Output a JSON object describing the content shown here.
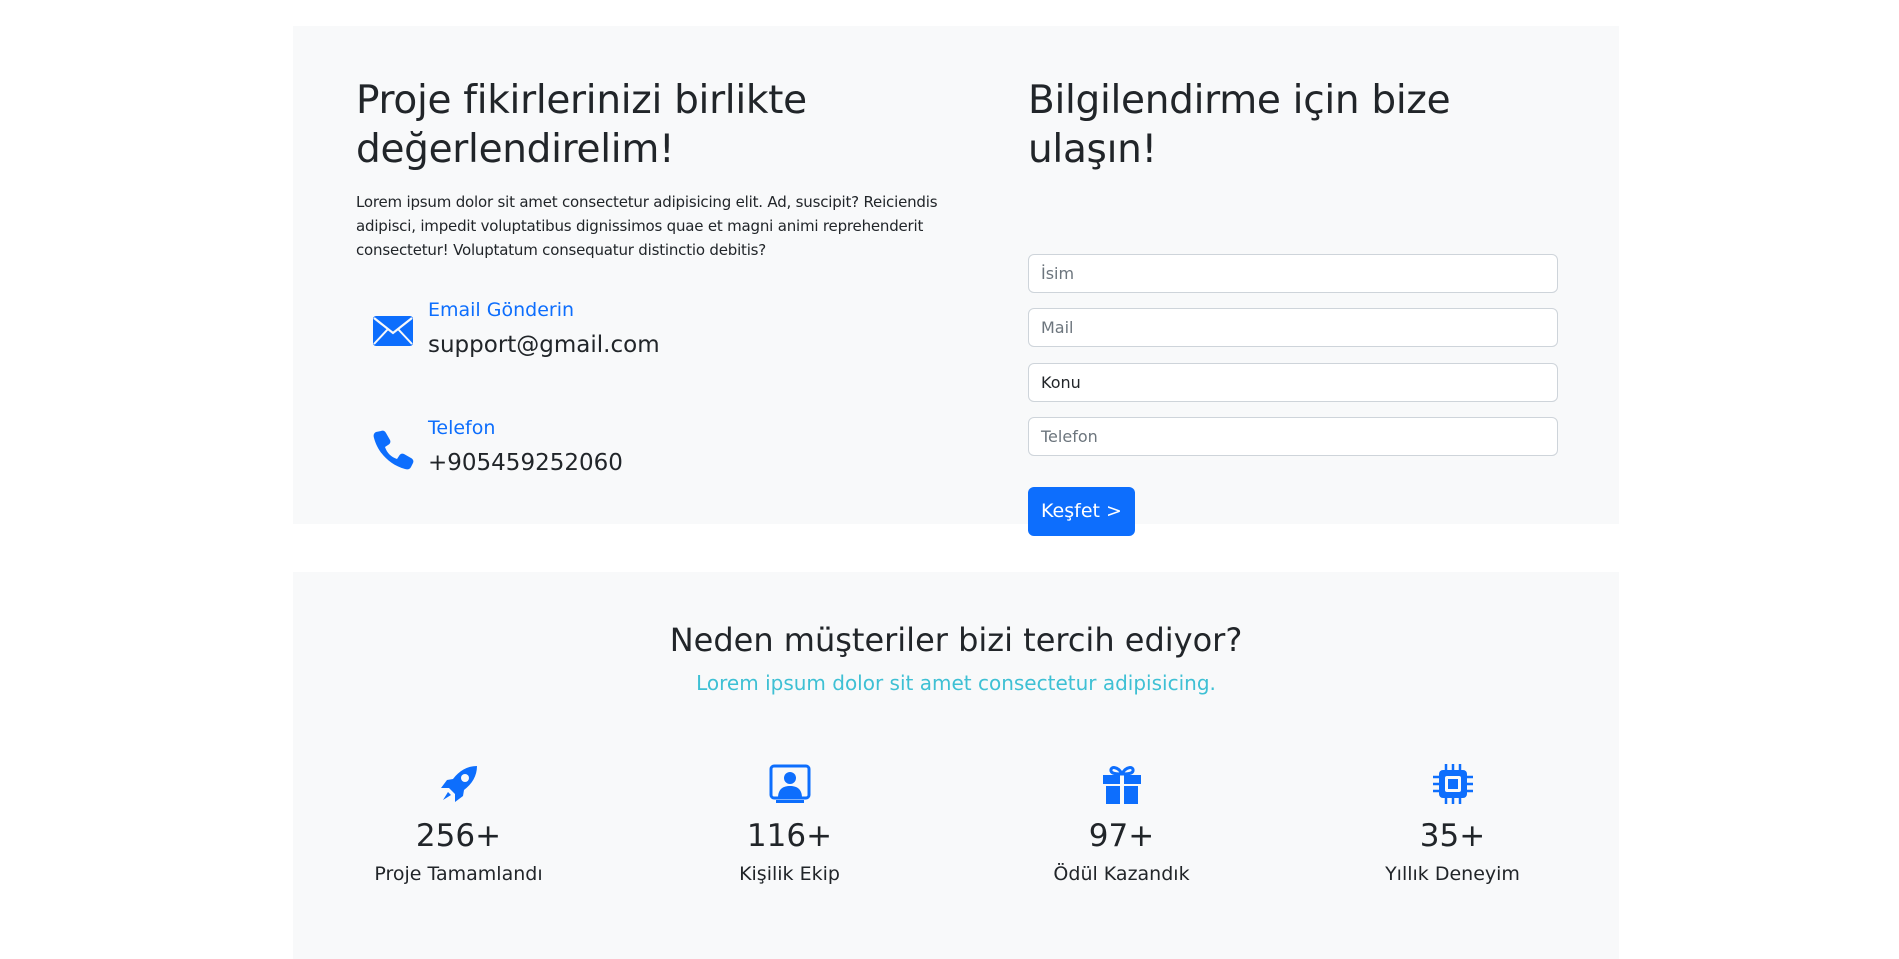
{
  "colors": {
    "accent": "#0d6efd",
    "section_bg": "#f8f9fa",
    "subtitle": "#3ec0d4",
    "text": "#212529"
  },
  "contact": {
    "title": "Proje fikirlerinizi birlikte değerlendirelim!",
    "description": "Lorem ipsum dolor sit amet consectetur adipisicing elit. Ad, suscipit? Reiciendis adipisci, impedit voluptatibus dignissimos quae et magni animi reprehenderit consectetur! Voluptatum consequatur distinctio debitis?",
    "email": {
      "icon": "envelope-icon",
      "label": "Email Gönderin",
      "value": "support@gmail.com"
    },
    "phone": {
      "icon": "phone-icon",
      "label": "Telefon",
      "value": "+905459252060"
    }
  },
  "form": {
    "title": "Bilgilendirme için bize ulaşın!",
    "name_placeholder": "İsim",
    "mail_placeholder": "Mail",
    "subject_value": "Konu",
    "phone_placeholder": "Telefon",
    "submit_label": "Keşfet >"
  },
  "stats": {
    "title": "Neden müşteriler bizi tercih ediyor?",
    "subtitle": "Lorem ipsum dolor sit amet consectetur adipisicing.",
    "items": [
      {
        "icon": "rocket-icon",
        "number": "256+",
        "label": "Proje Tamamlandı"
      },
      {
        "icon": "person-video-icon",
        "number": "116+",
        "label": "Kişilik Ekip"
      },
      {
        "icon": "gift-icon",
        "number": "97+",
        "label": "Ödül Kazandık"
      },
      {
        "icon": "cpu-icon",
        "number": "35+",
        "label": "Yıllık Deneyim"
      }
    ]
  }
}
